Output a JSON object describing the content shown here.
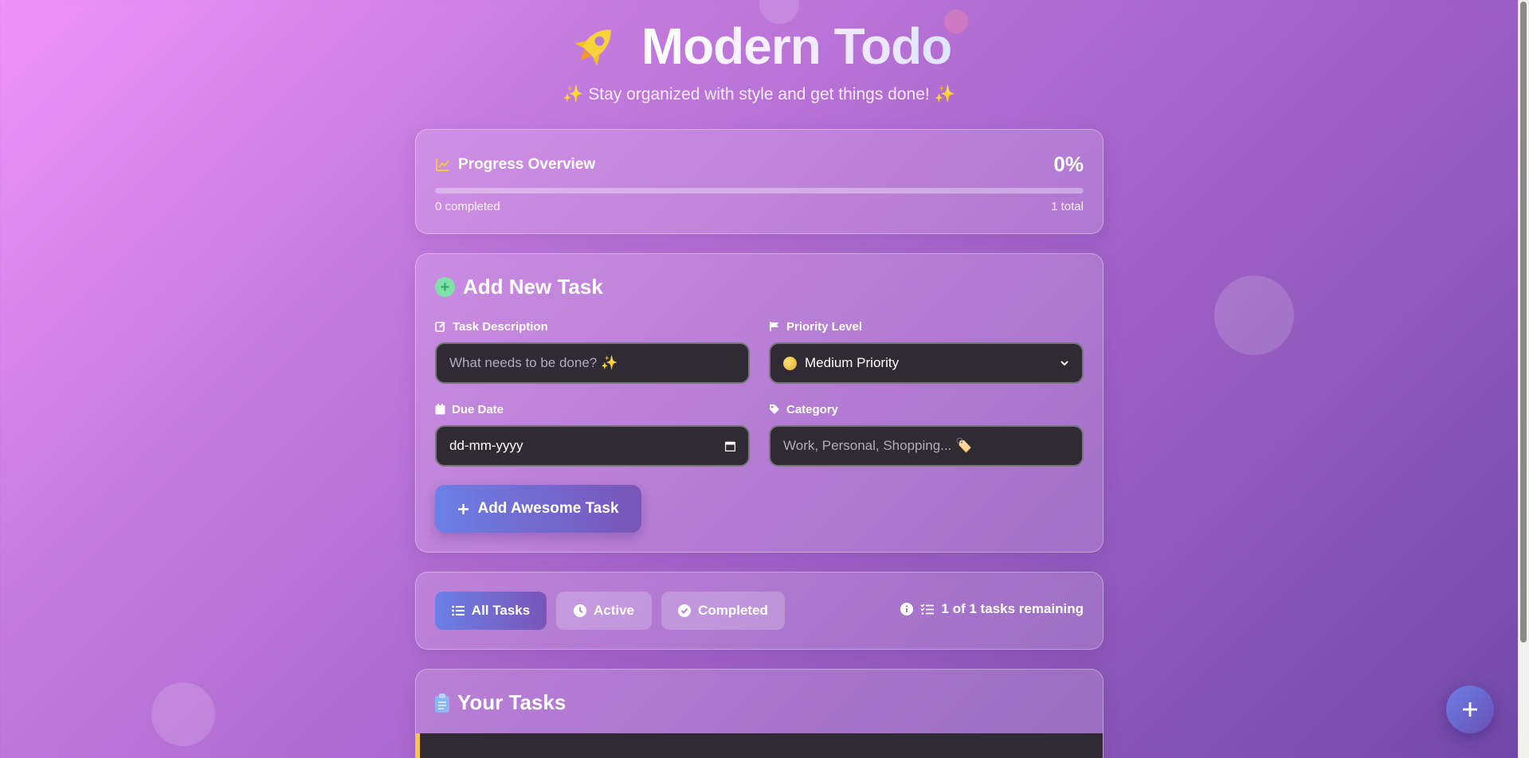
{
  "header": {
    "icon": "rocket-icon",
    "title": "Modern Todo",
    "subtitle": "✨ Stay organized with style and get things done! ✨"
  },
  "progress": {
    "icon": "chart-line-icon",
    "title": "Progress Overview",
    "percent_label": "0%",
    "percent_value": 0,
    "completed_label": "0 completed",
    "total_label": "1 total"
  },
  "add_task": {
    "icon": "plus-circle-icon",
    "title": "Add New Task",
    "description": {
      "label": "Task Description",
      "icon": "edit-icon",
      "placeholder": "What needs to be done? ✨",
      "value": ""
    },
    "priority": {
      "label": "Priority Level",
      "icon": "flag-icon",
      "selected": "Medium Priority",
      "selected_icon": "yellow-circle-icon"
    },
    "due_date": {
      "label": "Due Date",
      "icon": "calendar-icon",
      "placeholder": "dd-mm-yyyy",
      "value": ""
    },
    "category": {
      "label": "Category",
      "icon": "tag-icon",
      "placeholder": "Work, Personal, Shopping... 🏷️",
      "value": ""
    },
    "submit_label": "Add Awesome Task"
  },
  "filters": {
    "items": [
      {
        "label": "All Tasks",
        "icon": "list-icon",
        "active": true
      },
      {
        "label": "Active",
        "icon": "clock-icon",
        "active": false
      },
      {
        "label": "Completed",
        "icon": "check-circle-icon",
        "active": false
      }
    ],
    "remaining_label": "1 of 1 tasks remaining"
  },
  "tasks": {
    "icon": "clipboard-icon",
    "title": "Your Tasks"
  },
  "fab": {
    "icon": "plus-icon"
  },
  "colors": {
    "accent_start": "#6b7fe6",
    "accent_end": "#7a55b8",
    "input_bg": "#2f2a34",
    "priority_medium": "#f5c84a"
  }
}
